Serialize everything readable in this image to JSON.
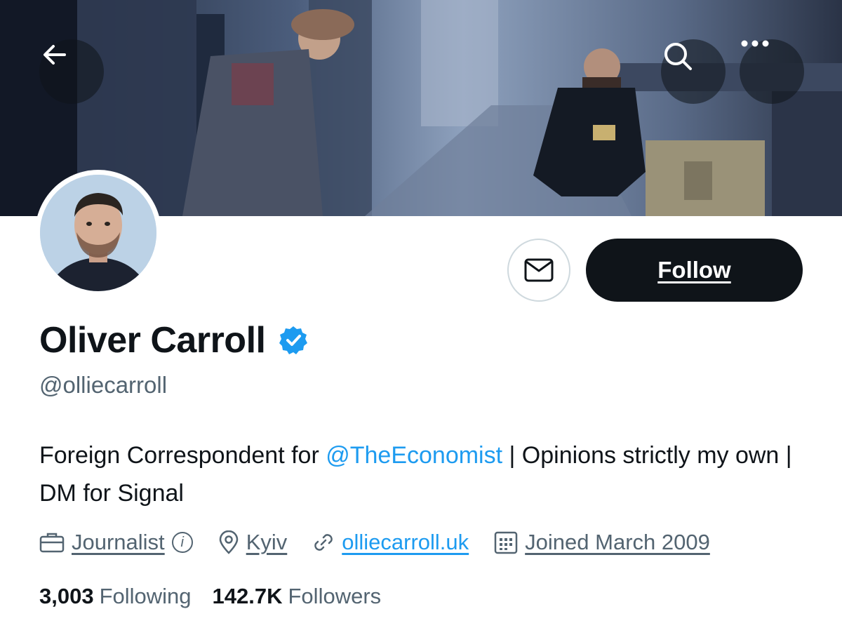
{
  "header": {
    "back_icon": "arrow-left-icon",
    "search_icon": "search-icon",
    "more_icon": "more-horizontal-icon"
  },
  "profile": {
    "name": "Oliver Carroll",
    "verified": true,
    "handle": "@olliecarroll",
    "bio": {
      "before": "Foreign Correspondent for ",
      "mention": "@TheEconomist",
      "after": " | Opinions strictly my own | DM for Signal"
    },
    "meta": {
      "category": "Journalist",
      "location": "Kyiv",
      "website": "olliecarroll.uk",
      "joined": "Joined March 2009"
    },
    "stats": {
      "following_count": "3,003",
      "following_label": "Following",
      "followers_count": "142.7K",
      "followers_label": "Followers"
    }
  },
  "actions": {
    "message_icon": "mail-icon",
    "follow_label": "Follow"
  },
  "colors": {
    "accent": "#1d9bf0",
    "text_primary": "#0f1419",
    "text_secondary": "#536471",
    "button_dark": "#0f1419"
  }
}
